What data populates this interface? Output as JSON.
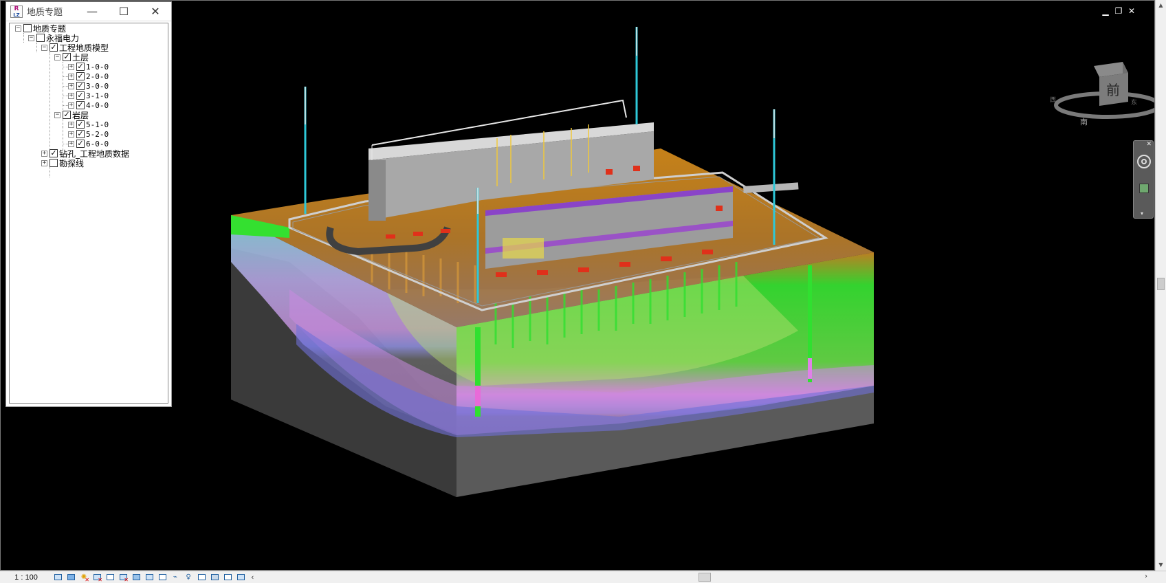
{
  "tree_panel": {
    "title": "地质专题",
    "logo": {
      "top": "R",
      "bottom": "LZ"
    },
    "controls": {
      "minimize": "—",
      "maximize": "☐",
      "close": "✕"
    },
    "nodes": [
      {
        "label": "地质专题",
        "checked": false,
        "expander": "−",
        "level": 0
      },
      {
        "label": "永福电力",
        "checked": false,
        "expander": "−",
        "level": 1
      },
      {
        "label": "工程地质模型",
        "checked": true,
        "expander": "−",
        "level": 2
      },
      {
        "label": "土层",
        "checked": true,
        "expander": "−",
        "level": 3
      },
      {
        "label": "1-0-0",
        "checked": true,
        "expander": "+",
        "level": 4
      },
      {
        "label": "2-0-0",
        "checked": true,
        "expander": "+",
        "level": 4
      },
      {
        "label": "3-0-0",
        "checked": true,
        "expander": "+",
        "level": 4
      },
      {
        "label": "3-1-0",
        "checked": true,
        "expander": "+",
        "level": 4
      },
      {
        "label": "4-0-0",
        "checked": true,
        "expander": "+",
        "level": 4
      },
      {
        "label": "岩层",
        "checked": true,
        "expander": "−",
        "level": 3
      },
      {
        "label": "5-1-0",
        "checked": true,
        "expander": "+",
        "level": 4
      },
      {
        "label": "5-2-0",
        "checked": true,
        "expander": "+",
        "level": 4
      },
      {
        "label": "6-0-0",
        "checked": true,
        "expander": "+",
        "level": 4
      },
      {
        "label": "钻孔_工程地质数据",
        "checked": true,
        "expander": "+",
        "level": 2
      },
      {
        "label": "勘探线",
        "checked": false,
        "expander": "+",
        "level": 2
      }
    ]
  },
  "viewport": {
    "window_controls": {
      "minimize": "▁",
      "restore": "❐",
      "close": "✕"
    },
    "viewcube": {
      "face": "前",
      "north_label": "南",
      "left_label": "西",
      "right_label": "东"
    },
    "nav_bar_close": "✕",
    "nav_bar_more": "▾"
  },
  "status_bar": {
    "scale": "1 : 100",
    "icons": [
      "detail-level-icon",
      "visual-style-icon",
      "sun-path-icon",
      "shadows-icon",
      "crop-view-icon",
      "show-crop-icon",
      "unlock-3d-icon",
      "temporary-hide-icon",
      "reveal-hidden-icon",
      "worksharing-icon",
      "highlight-displacement-icon",
      "analytical-model-icon",
      "constraints-icon",
      "design-options-icon"
    ],
    "scroll_left": "‹",
    "scroll_right": "›"
  },
  "colors": {
    "background": "#000000",
    "soil_orange": "#c8841a",
    "soil_green": "#36e62a",
    "soil_purple": "#a27fc8",
    "rock_gray": "#5e5e5e",
    "borehole_cyan": "#22c8d8"
  }
}
